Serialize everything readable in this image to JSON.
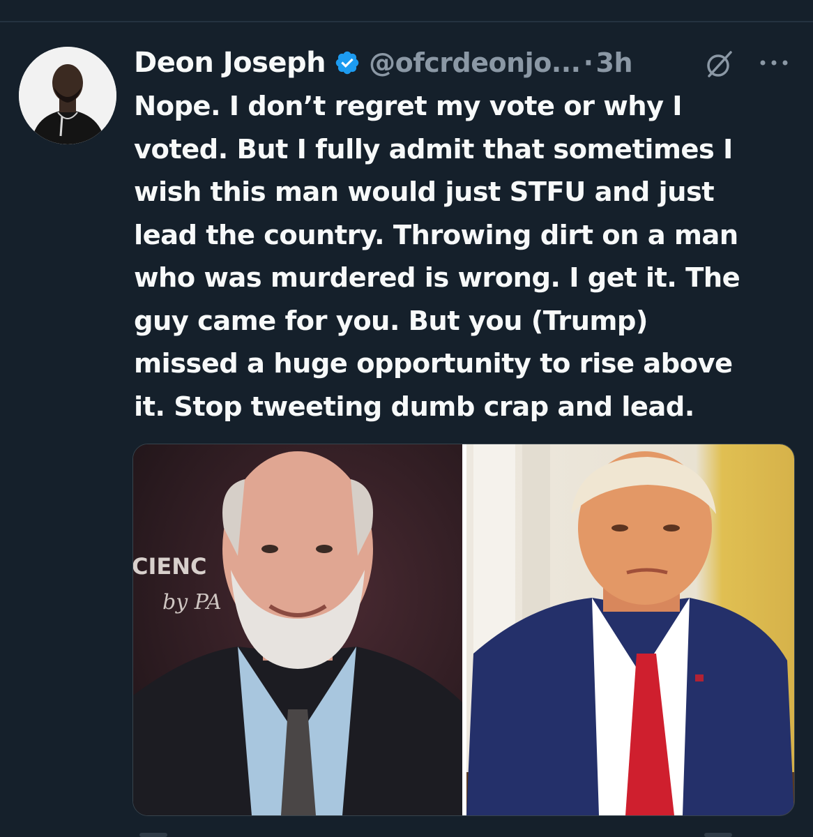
{
  "tweet": {
    "author_name": "Deon Joseph",
    "handle": "@ofcrdeonjo...",
    "separator": "·",
    "time": "3h",
    "text": "Nope. I don’t regret my vote or why I\nvoted. But I fully admit that sometimes I\nwish this man would just STFU and just\nlead the country. Throwing dirt on a man\nwho was murdered is wrong.  I get it. The\nguy came for you.  But you (Trump)\nmissed a huge opportunity to rise above\nit.  Stop tweeting dumb crap and lead.",
    "verified": true,
    "media": {
      "left_sign_line1": "CIENC",
      "left_sign_line2": "by PA"
    }
  },
  "icons": {
    "verified": "verified-badge-icon",
    "grok": "grok-icon",
    "more": "more-icon"
  },
  "colors": {
    "background": "#15202b",
    "text_primary": "#f7f9f9",
    "text_secondary": "#8b98a5",
    "verified_blue": "#1d9bf0"
  }
}
